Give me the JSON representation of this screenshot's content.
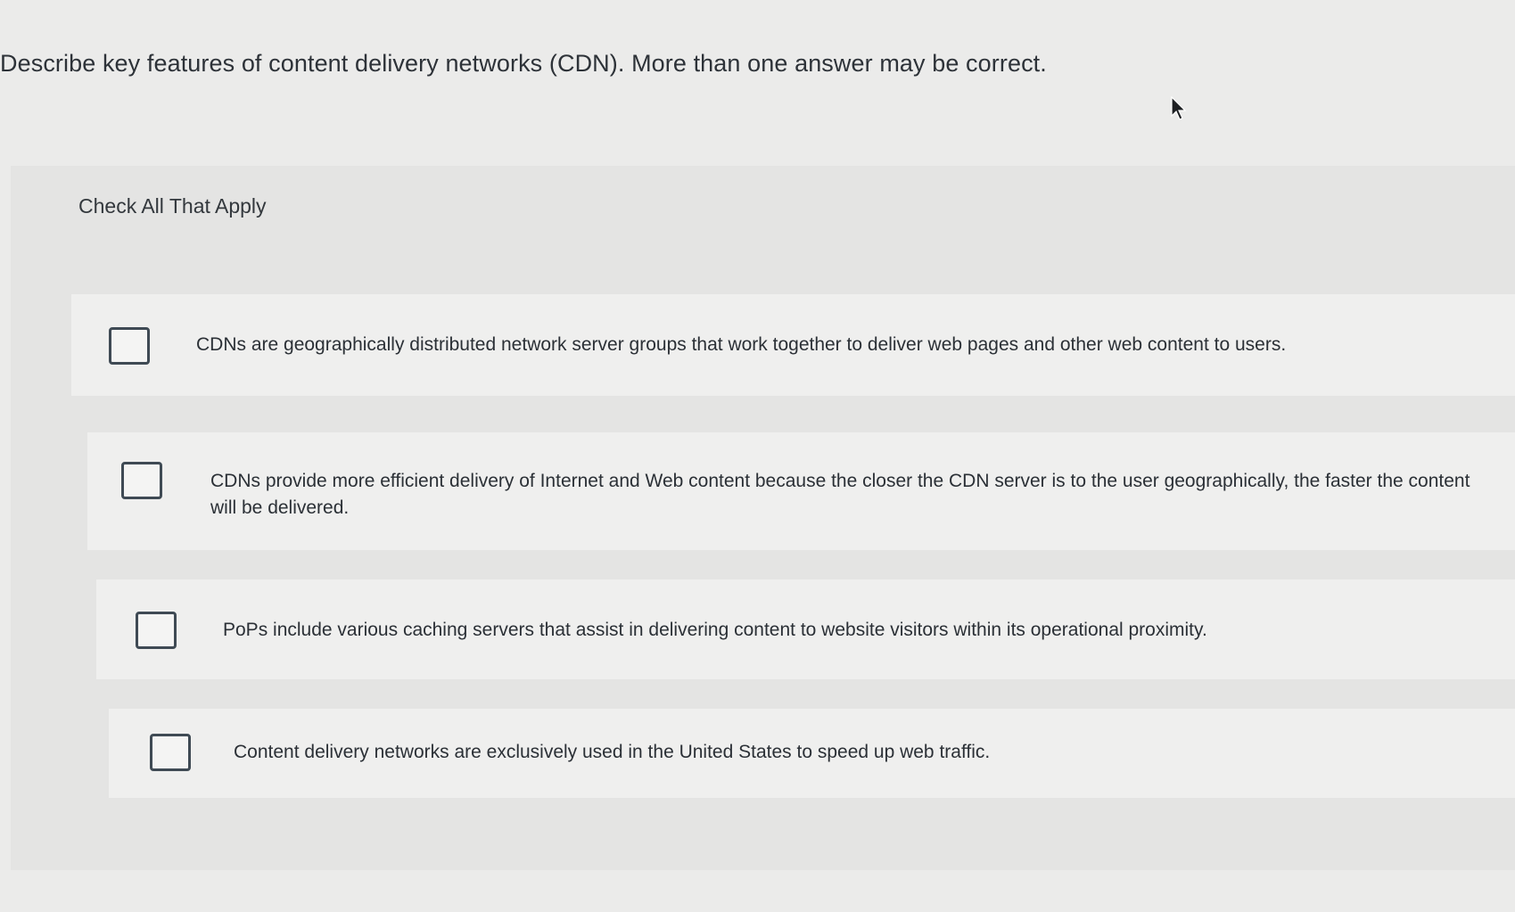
{
  "question": {
    "text": "Describe key features of content delivery networks (CDN). More than one answer may be correct."
  },
  "instruction": "Check All That Apply",
  "options": [
    {
      "label": "CDNs are geographically distributed network server groups that work together to deliver web pages and other web content to users.",
      "checked": false
    },
    {
      "label": "CDNs provide more efficient delivery of Internet and Web content because the closer the CDN server is to the user geographically, the faster the content will be delivered.",
      "checked": false
    },
    {
      "label": "PoPs include various caching servers that assist in delivering content to website visitors within its operational proximity.",
      "checked": false
    },
    {
      "label": "Content delivery networks are exclusively used in the United States to speed up web traffic.",
      "checked": false
    }
  ],
  "colors": {
    "background": "#ebebea",
    "panel": "#e4e4e3",
    "option_background": "#efefee",
    "checkbox_border": "#3f4a54",
    "text": "#2b3036"
  },
  "icons": {
    "cursor": "mouse-pointer-icon"
  }
}
